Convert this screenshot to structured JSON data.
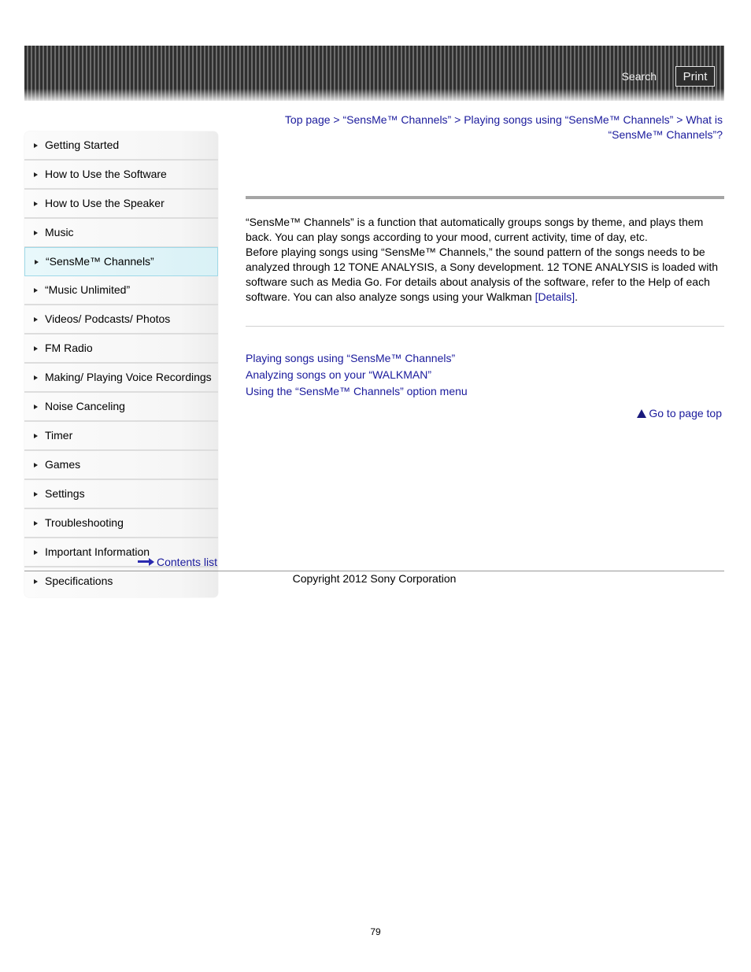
{
  "header": {
    "search_label": "Search",
    "print_label": "Print"
  },
  "breadcrumb": {
    "items": [
      "Top page",
      "“SensMe™ Channels”",
      "Playing songs using “SensMe™ Channels”",
      "What is “SensMe™ Channels”?"
    ],
    "separator": ">"
  },
  "sidebar": {
    "items": [
      {
        "label": "Getting Started",
        "active": false
      },
      {
        "label": "How to Use the Software",
        "active": false
      },
      {
        "label": "How to Use the Speaker",
        "active": false
      },
      {
        "label": "Music",
        "active": false
      },
      {
        "label": "“SensMe™ Channels”",
        "active": true
      },
      {
        "label": "“Music Unlimited”",
        "active": false
      },
      {
        "label": "Videos/ Podcasts/ Photos",
        "active": false
      },
      {
        "label": "FM Radio",
        "active": false
      },
      {
        "label": "Making/ Playing Voice Recordings",
        "active": false
      },
      {
        "label": "Noise Canceling",
        "active": false
      },
      {
        "label": "Timer",
        "active": false
      },
      {
        "label": "Games",
        "active": false
      },
      {
        "label": "Settings",
        "active": false
      },
      {
        "label": "Troubleshooting",
        "active": false
      },
      {
        "label": "Important Information",
        "active": false
      },
      {
        "label": "Specifications",
        "active": false
      }
    ],
    "contents_list_label": "Contents list"
  },
  "main": {
    "paragraph_1": "“SensMe™ Channels” is a function that automatically groups songs by theme, and plays them back. You can play songs according to your mood, current activity, time of day, etc.",
    "paragraph_2": "Before playing songs using “SensMe™ Channels,” the sound pattern of the songs needs to be analyzed through 12 TONE ANALYSIS, a Sony development. 12 TONE ANALYSIS is loaded with software such as Media Go. For details about analysis of the software, refer to the Help of each software. You can also analyze songs using your Walkman ",
    "details_link": "[Details]",
    "paragraph_2_end": ".",
    "related_links": [
      "Playing songs using “SensMe™ Channels”",
      "Analyzing songs on your “WALKMAN”",
      "Using the “SensMe™ Channels” option menu"
    ],
    "go_to_top_label": "Go to page top"
  },
  "footer": {
    "copyright": "Copyright 2012 Sony Corporation",
    "page_number": "79"
  },
  "colors": {
    "link": "#1a1a9c",
    "active_nav_bg": "#d9f1f6",
    "active_nav_border": "#9fd9e8"
  }
}
